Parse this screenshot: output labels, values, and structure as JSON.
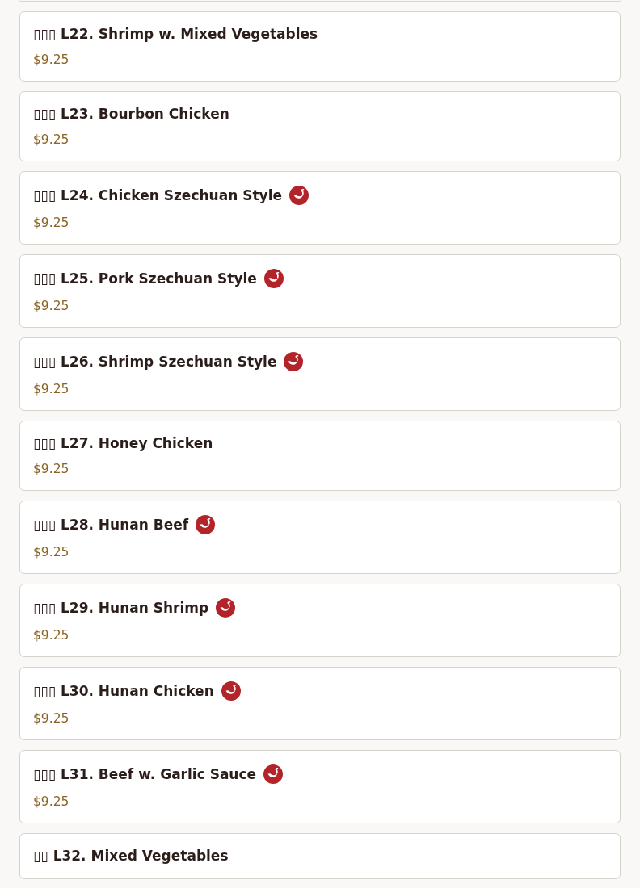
{
  "menu_items": [
    {
      "name": "▯▯▯ L22. Shrimp w. Mixed Vegetables",
      "price": "$9.25",
      "spicy": false
    },
    {
      "name": "▯▯▯ L23. Bourbon Chicken",
      "price": "$9.25",
      "spicy": false
    },
    {
      "name": "▯▯▯ L24. Chicken Szechuan Style",
      "price": "$9.25",
      "spicy": true
    },
    {
      "name": "▯▯▯ L25. Pork Szechuan Style",
      "price": "$9.25",
      "spicy": true
    },
    {
      "name": "▯▯▯ L26. Shrimp Szechuan Style",
      "price": "$9.25",
      "spicy": true
    },
    {
      "name": "▯▯▯ L27. Honey Chicken",
      "price": "$9.25",
      "spicy": false
    },
    {
      "name": "▯▯▯ L28. Hunan Beef",
      "price": "$9.25",
      "spicy": true
    },
    {
      "name": "▯▯▯ L29. Hunan Shrimp",
      "price": "$9.25",
      "spicy": true
    },
    {
      "name": "▯▯▯ L30. Hunan Chicken",
      "price": "$9.25",
      "spicy": true
    },
    {
      "name": "▯▯▯ L31. Beef w. Garlic Sauce",
      "price": "$9.25",
      "spicy": true
    },
    {
      "name": "▯▯ L32. Mixed Vegetables",
      "spicy": false
    }
  ]
}
